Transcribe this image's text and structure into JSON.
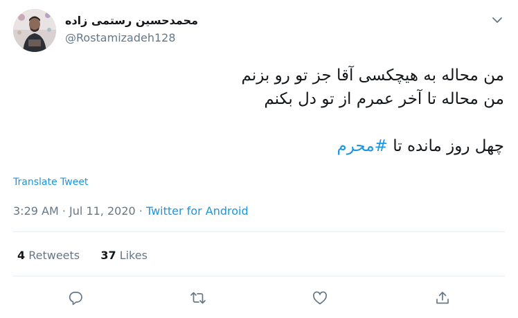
{
  "author": {
    "display_name": "محمدحسین رستمی زاده",
    "handle": "@Rostamizadeh128"
  },
  "tweet": {
    "line1": "من محاله به هیچکسی آقا جز تو رو بزنم",
    "line2": "من محاله تا آخر عمرم از تو دل بکنم",
    "line3_prefix": "چهل روز مانده تا ",
    "hashtag": "#محرم"
  },
  "translate_label": "Translate Tweet",
  "meta": {
    "time": "3:29 AM",
    "separator": "·",
    "date": "Jul 11, 2020",
    "source": "Twitter for Android"
  },
  "stats": {
    "retweets_count": "4",
    "retweets_label": "Retweets",
    "likes_count": "37",
    "likes_label": "Likes"
  },
  "icons": {
    "caret": "chevron-down-icon",
    "reply": "reply-icon",
    "retweet": "retweet-icon",
    "like": "heart-icon",
    "share": "share-icon"
  },
  "colors": {
    "link": "#1b95e0",
    "secondary_text": "#657786",
    "primary_text": "#14171a",
    "divider": "#e6ecf0"
  }
}
